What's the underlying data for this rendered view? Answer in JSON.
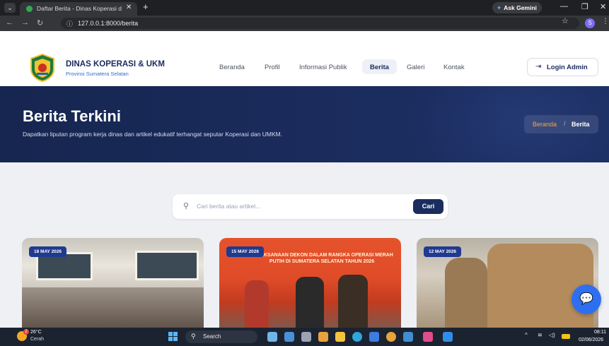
{
  "browser": {
    "tab_title": "Daftar Berita - Dinas Koperasi d",
    "tab_close": "✕",
    "new_tab": "+",
    "gemini_label": "Ask Gemini",
    "url": "127.0.0.1:8000/berita",
    "profile_initial": "S"
  },
  "header": {
    "brand_title": "DINAS KOPERASI & UKM",
    "brand_subtitle": "Provinsi Sumatera Selatan",
    "nav": [
      "Beranda",
      "Profil",
      "Informasi Publik",
      "Berita",
      "Galeri",
      "Kontak"
    ],
    "active_nav": "Berita",
    "login_label": "Login Admin"
  },
  "hero": {
    "title": "Berita Terkini",
    "description": "Dapatkan liputan program kerja dinas dan artikel edukatif terhangat seputar Koperasi dan UMKM.",
    "breadcrumb_home": "Beranda",
    "breadcrumb_sep": "/",
    "breadcrumb_current": "Berita"
  },
  "search": {
    "placeholder": "Cari berita atau artikel...",
    "button_label": "Cari"
  },
  "cards": [
    {
      "date": "18 MAY 2026"
    },
    {
      "date": "15 MAY 2026",
      "banner_text": "PELAKSANAAN DEKON DALAM RANGKA OPERASI MERAH PUTIH DI SUMATERA SELATAN TAHUN 2026"
    },
    {
      "date": "12 MAY 2026"
    }
  ],
  "taskbar": {
    "temperature": "26°C",
    "condition": "Cerah",
    "weather_badge": "2",
    "search_label": "Search",
    "time": "08:11",
    "date": "02/06/2026"
  },
  "colors": {
    "primary": "#1b2c5e",
    "accent": "#f2a541",
    "badge": "#1f3a8f",
    "chat": "#2d6ff0"
  }
}
